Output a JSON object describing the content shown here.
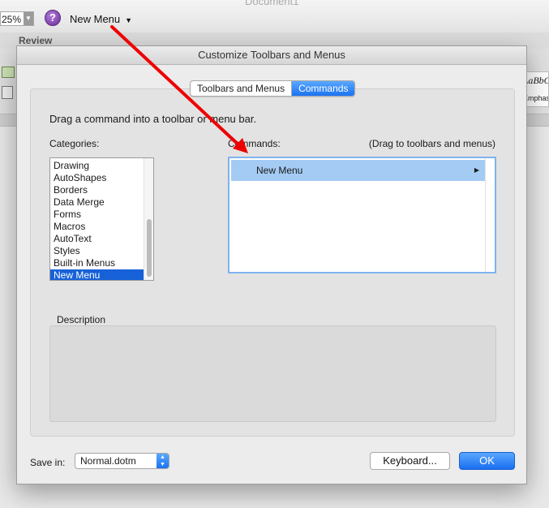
{
  "app": {
    "doc_title": "Document1",
    "zoom": "25%",
    "help_label": "?",
    "new_menu_label": "New Menu",
    "ribbon_tab": "Review",
    "styles_preview_text": "AaBbCcDdEe",
    "styles_preview_sub": "Emphasis"
  },
  "dialog": {
    "title": "Customize Toolbars and Menus",
    "tabs": [
      {
        "label": "Toolbars and Menus",
        "active": false
      },
      {
        "label": "Commands",
        "active": true
      }
    ],
    "instruction": "Drag a command into a toolbar or menu bar.",
    "categories_label": "Categories:",
    "commands_label": "Commands:",
    "commands_hint": "(Drag to toolbars and menus)",
    "categories": [
      "Drawing",
      "AutoShapes",
      "Borders",
      "Data Merge",
      "Forms",
      "Macros",
      "AutoText",
      "Styles",
      "Built-in Menus",
      "New Menu"
    ],
    "selected_category": "New Menu",
    "commands": [
      {
        "label": "New Menu",
        "has_submenu": true
      }
    ],
    "description_label": "Description",
    "description_text": "",
    "save_in_label": "Save in:",
    "save_in_value": "Normal.dotm",
    "keyboard_button": "Keyboard...",
    "ok_button": "OK"
  },
  "annotation": {
    "arrow_color": "#ee0000"
  },
  "colors": {
    "accent": "#1a73f2",
    "selection": "#1761d8",
    "command_highlight": "#a4cbf4"
  }
}
